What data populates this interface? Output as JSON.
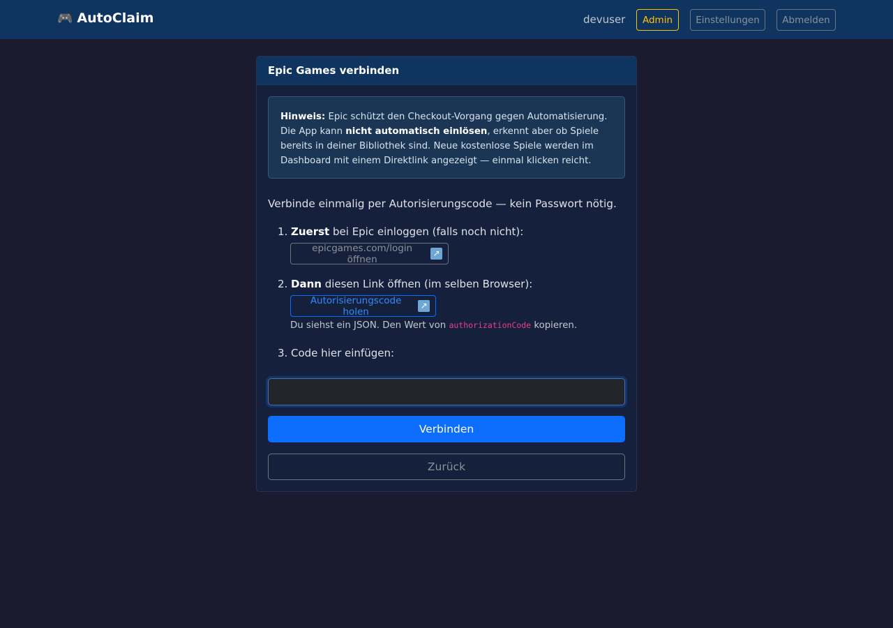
{
  "navbar": {
    "brand_icon": "🎮",
    "brand_icon_name": "gamepad-icon",
    "brand": "AutoClaim",
    "user": "devuser",
    "admin_label": "Admin",
    "settings_label": "Einstellungen",
    "logout_label": "Abmelden"
  },
  "card": {
    "title": "Epic Games verbinden",
    "notice": {
      "lead": "Hinweis:",
      "text1": " Epic schützt den Checkout-Vorgang gegen Automatisierung. Die App kann ",
      "emph": "nicht automatisch einlösen",
      "text2": ", erkennt aber ob Spiele bereits in deiner Bibliothek sind. Neue kostenlose Spiele werden im Dashboard mit einem Direktlink angezeigt — einmal klicken reicht."
    },
    "intro": "Verbinde einmalig per Autorisierungscode — kein Passwort nötig.",
    "steps": [
      {
        "num": "1.",
        "bold": "Zuerst",
        "text": " bei Epic einloggen (falls noch nicht):"
      },
      {
        "num": "2.",
        "bold": "Dann",
        "text": " diesen Link öffnen (im selben Browser):"
      },
      {
        "num": "3.",
        "text": "Code hier einfügen:"
      }
    ],
    "login_link": "epicgames.com/login öffnen",
    "auth_link": "Autorisierungscode holen",
    "external_icon": "↗",
    "hint_pre": "Du siehst ein JSON. Den Wert von ",
    "hint_code": "authorizationCode",
    "hint_post": " kopieren.",
    "code_input_value": "",
    "connect_label": "Verbinden",
    "back_label": "Zurück"
  },
  "colors": {
    "background": "#1b1a2e",
    "navbar": "#0f3460",
    "primary": "#0d6efd",
    "warning": "#ffc107",
    "code": "#e83e8c"
  }
}
